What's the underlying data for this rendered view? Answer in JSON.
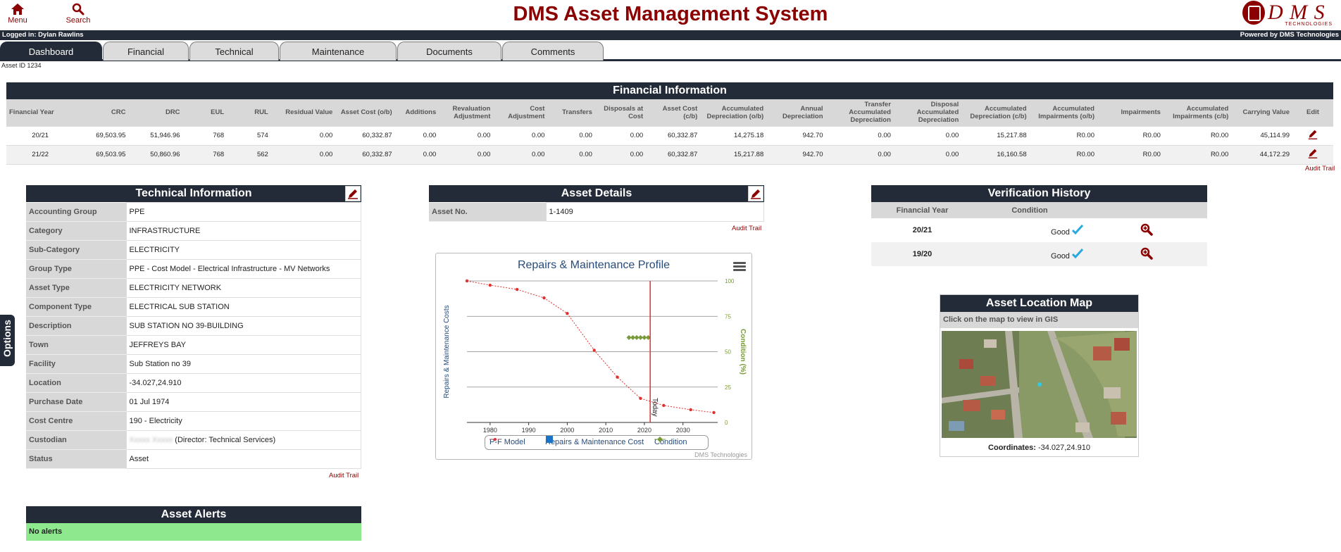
{
  "header": {
    "title": "DMS Asset Management System",
    "menu_label": "Menu",
    "search_label": "Search",
    "logo_text": "D M S",
    "logo_sub": "TECHNOLOGIES"
  },
  "status": {
    "logged_in": "Logged in: Dylan Rawlins",
    "powered_by": "Powered by DMS Technologies"
  },
  "tabs": [
    {
      "label": "Dashboard",
      "active": true
    },
    {
      "label": "Financial"
    },
    {
      "label": "Technical"
    },
    {
      "label": "Maintenance"
    },
    {
      "label": "Documents"
    },
    {
      "label": "Comments"
    }
  ],
  "asset_id": "Asset ID 1234",
  "financial": {
    "title": "Financial Information",
    "columns": [
      "Financial Year",
      "CRC",
      "DRC",
      "EUL",
      "RUL",
      "Residual Value",
      "Asset Cost (o/b)",
      "Additions",
      "Revaluation Adjustment",
      "Cost Adjustment",
      "Transfers",
      "Disposals at Cost",
      "Asset Cost (c/b)",
      "Accumulated Depreciation (o/b)",
      "Annual Depreciation",
      "Transfer Accumulated Depreciation",
      "Disposal Accumulated Depreciation",
      "Accumulated Depreciation (c/b)",
      "Accumulated Impairments (o/b)",
      "Impairments",
      "Accumulated Impairments (c/b)",
      "Carrying Value",
      "Edit"
    ],
    "rows": [
      [
        "20/21",
        "69,503.95",
        "51,946.96",
        "768",
        "574",
        "0.00",
        "60,332.87",
        "0.00",
        "0.00",
        "0.00",
        "0.00",
        "0.00",
        "60,332.87",
        "14,275.18",
        "942.70",
        "0.00",
        "0.00",
        "15,217.88",
        "R0.00",
        "R0.00",
        "R0.00",
        "45,114.99"
      ],
      [
        "21/22",
        "69,503.95",
        "50,860.96",
        "768",
        "562",
        "0.00",
        "60,332.87",
        "0.00",
        "0.00",
        "0.00",
        "0.00",
        "0.00",
        "60,332.87",
        "15,217.88",
        "942.70",
        "0.00",
        "0.00",
        "16,160.58",
        "R0.00",
        "R0.00",
        "R0.00",
        "44,172.29"
      ]
    ],
    "audit_trail": "Audit Trail"
  },
  "technical": {
    "title": "Technical Information",
    "rows": [
      {
        "k": "Accounting Group",
        "v": "PPE"
      },
      {
        "k": "Category",
        "v": "INFRASTRUCTURE"
      },
      {
        "k": "Sub-Category",
        "v": "ELECTRICITY"
      },
      {
        "k": "Group Type",
        "v": "PPE - Cost Model - Electrical Infrastructure - MV Networks"
      },
      {
        "k": "Asset Type",
        "v": "ELECTRICITY NETWORK"
      },
      {
        "k": "Component Type",
        "v": "ELECTRICAL SUB STATION"
      },
      {
        "k": "Description",
        "v": "SUB STATION NO 39-BUILDING"
      },
      {
        "k": "Town",
        "v": "JEFFREYS BAY"
      },
      {
        "k": "Facility",
        "v": "Sub Station no 39"
      },
      {
        "k": "Location",
        "v": "-34.027,24.910"
      },
      {
        "k": "Purchase Date",
        "v": "01 Jul 1974"
      },
      {
        "k": "Cost Centre",
        "v": "190 - Electricity"
      },
      {
        "k": "Custodian",
        "v": "(Director: Technical Services)",
        "blurred": "Xxxxx Xxxxx"
      },
      {
        "k": "Status",
        "v": "Asset"
      }
    ],
    "audit_trail": "Audit Trail"
  },
  "details": {
    "title": "Asset Details",
    "asset_no_label": "Asset No.",
    "asset_no": "1-1409",
    "audit_trail": "Audit Trail"
  },
  "chart_data": {
    "type": "line",
    "title": "Repairs & Maintenance Profile",
    "ylabel": "Repairs & Maintenance Costs",
    "y2label": "Condition (%)",
    "xlim": [
      1974,
      2039
    ],
    "x_ticks": [
      1980,
      1990,
      2000,
      2010,
      2020,
      2030
    ],
    "y2_ticks": [
      0,
      25,
      50,
      75,
      100
    ],
    "y2lim": [
      0,
      100
    ],
    "today_x": 2021.5,
    "today_label": "Today",
    "credit": "DMS Technologies",
    "series": [
      {
        "name": "P-F Model",
        "color": "#e03030",
        "x": [
          1974,
          1980,
          1987,
          1994,
          2000,
          2007,
          2013,
          2019,
          2025,
          2032,
          2038
        ],
        "y": [
          100,
          97,
          94,
          88,
          77,
          51,
          32,
          17,
          12,
          9,
          7
        ]
      },
      {
        "name": "Repairs & Maintenance Cost",
        "color": "#1a73c6",
        "x": [],
        "y": []
      },
      {
        "name": "Condition",
        "color": "#7a9a3a",
        "x": [
          2016,
          2017,
          2018,
          2019,
          2020,
          2021
        ],
        "y": [
          60,
          60,
          60,
          60,
          60,
          60
        ]
      }
    ],
    "legend": "bottom-center"
  },
  "verification": {
    "title": "Verification History",
    "col_year": "Financial Year",
    "col_condition": "Condition",
    "rows": [
      {
        "year": "20/21",
        "condition": "Good"
      },
      {
        "year": "19/20",
        "condition": "Good"
      }
    ]
  },
  "map": {
    "title": "Asset Location Map",
    "hint": "Click on the map to view in GIS",
    "coords_label": "Coordinates:",
    "coords": "-34.027,24.910"
  },
  "alerts": {
    "title": "Asset Alerts",
    "message": "No alerts"
  },
  "options_label": "Options",
  "colors": {
    "brand": "#8b0000",
    "dark": "#232b38",
    "ok": "#8ee88e"
  }
}
